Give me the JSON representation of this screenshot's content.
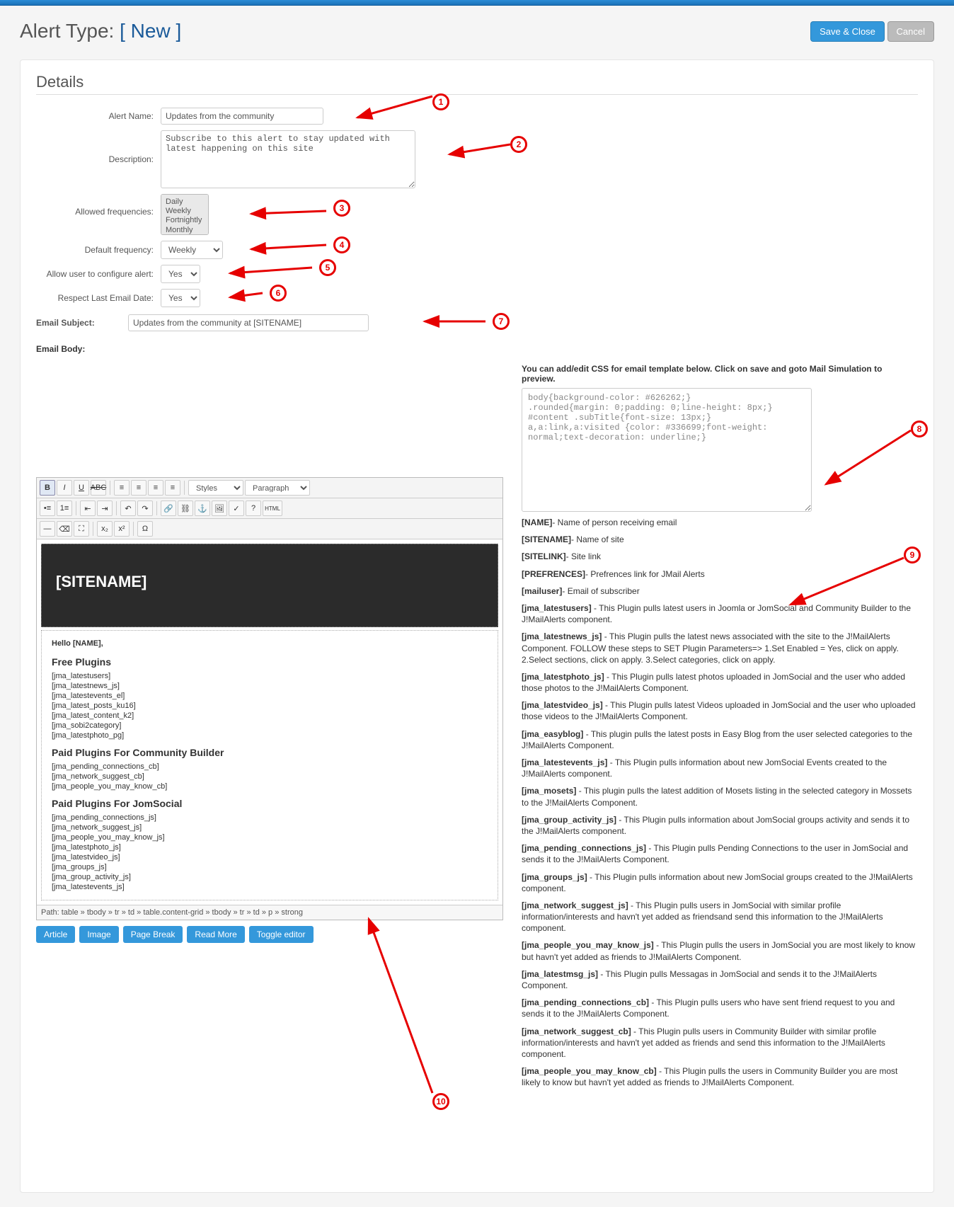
{
  "header": {
    "title_prefix": "Alert Type: ",
    "title_new": "[ New ]",
    "save_close": "Save & Close",
    "cancel": "Cancel"
  },
  "section_title": "Details",
  "labels": {
    "alert_name": "Alert Name:",
    "description": "Description:",
    "allowed_freq": "Allowed frequencies:",
    "default_freq": "Default frequency:",
    "allow_user": "Allow user to configure alert:",
    "respect_last": "Respect Last Email Date:",
    "email_subject": "Email Subject:",
    "email_body": "Email Body:"
  },
  "values": {
    "alert_name": "Updates from the community",
    "description": "Subscribe to this alert to stay updated with latest happening on this site",
    "freq_options": [
      "Daily",
      "Weekly",
      "Fortnightly",
      "Monthly"
    ],
    "default_freq": "Weekly",
    "allow_user": "Yes",
    "respect_last": "Yes",
    "email_subject": "Updates from the community at [SITENAME]"
  },
  "right": {
    "intro": "You can add/edit CSS for email template below. Click on save and goto Mail Simulation to preview.",
    "css": "body{background-color: #626262;}\n.rounded{margin: 0;padding: 0;line-height: 8px;}\n#content .subTitle{font-size: 13px;}\na,a:link,a:visited {color: #336699;font-weight: normal;text-decoration: underline;}",
    "vars": [
      {
        "k": "[NAME]",
        "d": "- Name of person receiving email"
      },
      {
        "k": "[SITENAME]",
        "d": "- Name of site"
      },
      {
        "k": "[SITELINK]",
        "d": "- Site link"
      },
      {
        "k": "[PREFRENCES]",
        "d": "- Prefrences link for JMail Alerts"
      },
      {
        "k": "[mailuser]",
        "d": "- Email of subscriber"
      }
    ],
    "plugins": [
      {
        "k": "[jma_latestusers]",
        "d": " - This Plugin pulls latest users in Joomla or JomSocial and Community Builder to the J!MailAlerts component."
      },
      {
        "k": "[jma_latestnews_js]",
        "d": " - This Plugin pulls the latest news associated with the site to the J!MailAlerts Component. FOLLOW these steps to SET Plugin Parameters=> 1.Set Enabled = Yes, click on apply. 2.Select sections, click on apply. 3.Select categories, click on apply."
      },
      {
        "k": "[jma_latestphoto_js]",
        "d": " - This Plugin pulls latest photos uploaded in JomSocial and the user who added those photos to the J!MailAlerts Component."
      },
      {
        "k": "[jma_latestvideo_js]",
        "d": " - This Plugin pulls latest Videos uploaded in JomSocial and the user who uploaded those videos to the J!MailAlerts Component."
      },
      {
        "k": "[jma_easyblog]",
        "d": " - This plugin pulls the latest posts in Easy Blog from the user selected categories to the J!MailAlerts Component."
      },
      {
        "k": "[jma_latestevents_js]",
        "d": " - This Plugin pulls information about new JomSocial Events created to the J!MailAlerts component."
      },
      {
        "k": "[jma_mosets]",
        "d": " - This plugin pulls the latest addition of Mosets listing in the selected category in Mossets to the J!MailAlerts Component."
      },
      {
        "k": "[jma_group_activity_js]",
        "d": " - This Plugin pulls information about JomSocial groups activity and sends it to the J!MailAlerts component."
      },
      {
        "k": "[jma_pending_connections_js]",
        "d": " - This Plugin pulls Pending Connections to the user in JomSocial and sends it to the J!MailAlerts Component."
      },
      {
        "k": "[jma_groups_js]",
        "d": " - This Plugin pulls information about new JomSocial groups created to the J!MailAlerts component."
      },
      {
        "k": "[jma_network_suggest_js]",
        "d": " - This Plugin pulls users in JomSocial with similar profile information/interests and havn't yet added as friendsand send this information to the J!MailAlerts component."
      },
      {
        "k": "[jma_people_you_may_know_js]",
        "d": " - This Plugin pulls the users in JomSocial you are most likely to know but havn't yet added as friends to J!MailAlerts Component."
      },
      {
        "k": "[jma_latestmsg_js]",
        "d": " - This Plugin pulls Messagas in JomSocial and sends it to the J!MailAlerts Component."
      },
      {
        "k": "[jma_pending_connections_cb]",
        "d": " - This Plugin pulls users who have sent friend request to you and sends it to the J!MailAlerts Component."
      },
      {
        "k": "[jma_network_suggest_cb]",
        "d": " - This Plugin pulls users in Community Builder with similar profile information/interests and havn't yet added as friends and send this information to the J!MailAlerts component."
      },
      {
        "k": "[jma_people_you_may_know_cb]",
        "d": " - This Plugin pulls the users in Community Builder you are most likely to know but havn't yet added as friends to J!MailAlerts Component."
      }
    ]
  },
  "editor": {
    "styles": "Styles",
    "paragraph": "Paragraph",
    "sitebanner": "[SITENAME]",
    "hello": "Hello [NAME],",
    "free_title": "Free Plugins",
    "free_list": [
      "[jma_latestusers]",
      "[jma_latestnews_js]",
      "[jma_latestevents_el]",
      "[jma_latest_posts_ku16]",
      "[jma_latest_content_k2]",
      "[jma_sobi2category]",
      "[jma_latestphoto_pg]"
    ],
    "paid_cb_title": "Paid Plugins For Community Builder",
    "paid_cb_list": [
      "[jma_pending_connections_cb]",
      "[jma_network_suggest_cb]",
      "[jma_people_you_may_know_cb]"
    ],
    "paid_js_title": "Paid Plugins For JomSocial",
    "paid_js_list": [
      "[jma_pending_connections_js]",
      "[jma_network_suggest_js]",
      "[jma_people_you_may_know_js]",
      "[jma_latestphoto_js]",
      "[jma_latestvideo_js]",
      "[jma_groups_js]",
      "[jma_group_activity_js]",
      "[jma_latestevents_js]"
    ],
    "path": "Path: table » tbody » tr » td » table.content-grid » tbody » tr » td » p » strong",
    "btns": {
      "article": "Article",
      "image": "Image",
      "pagebreak": "Page Break",
      "readmore": "Read More",
      "toggle": "Toggle editor"
    }
  },
  "annotations": [
    "1",
    "2",
    "3",
    "4",
    "5",
    "6",
    "7",
    "8",
    "9",
    "10"
  ]
}
